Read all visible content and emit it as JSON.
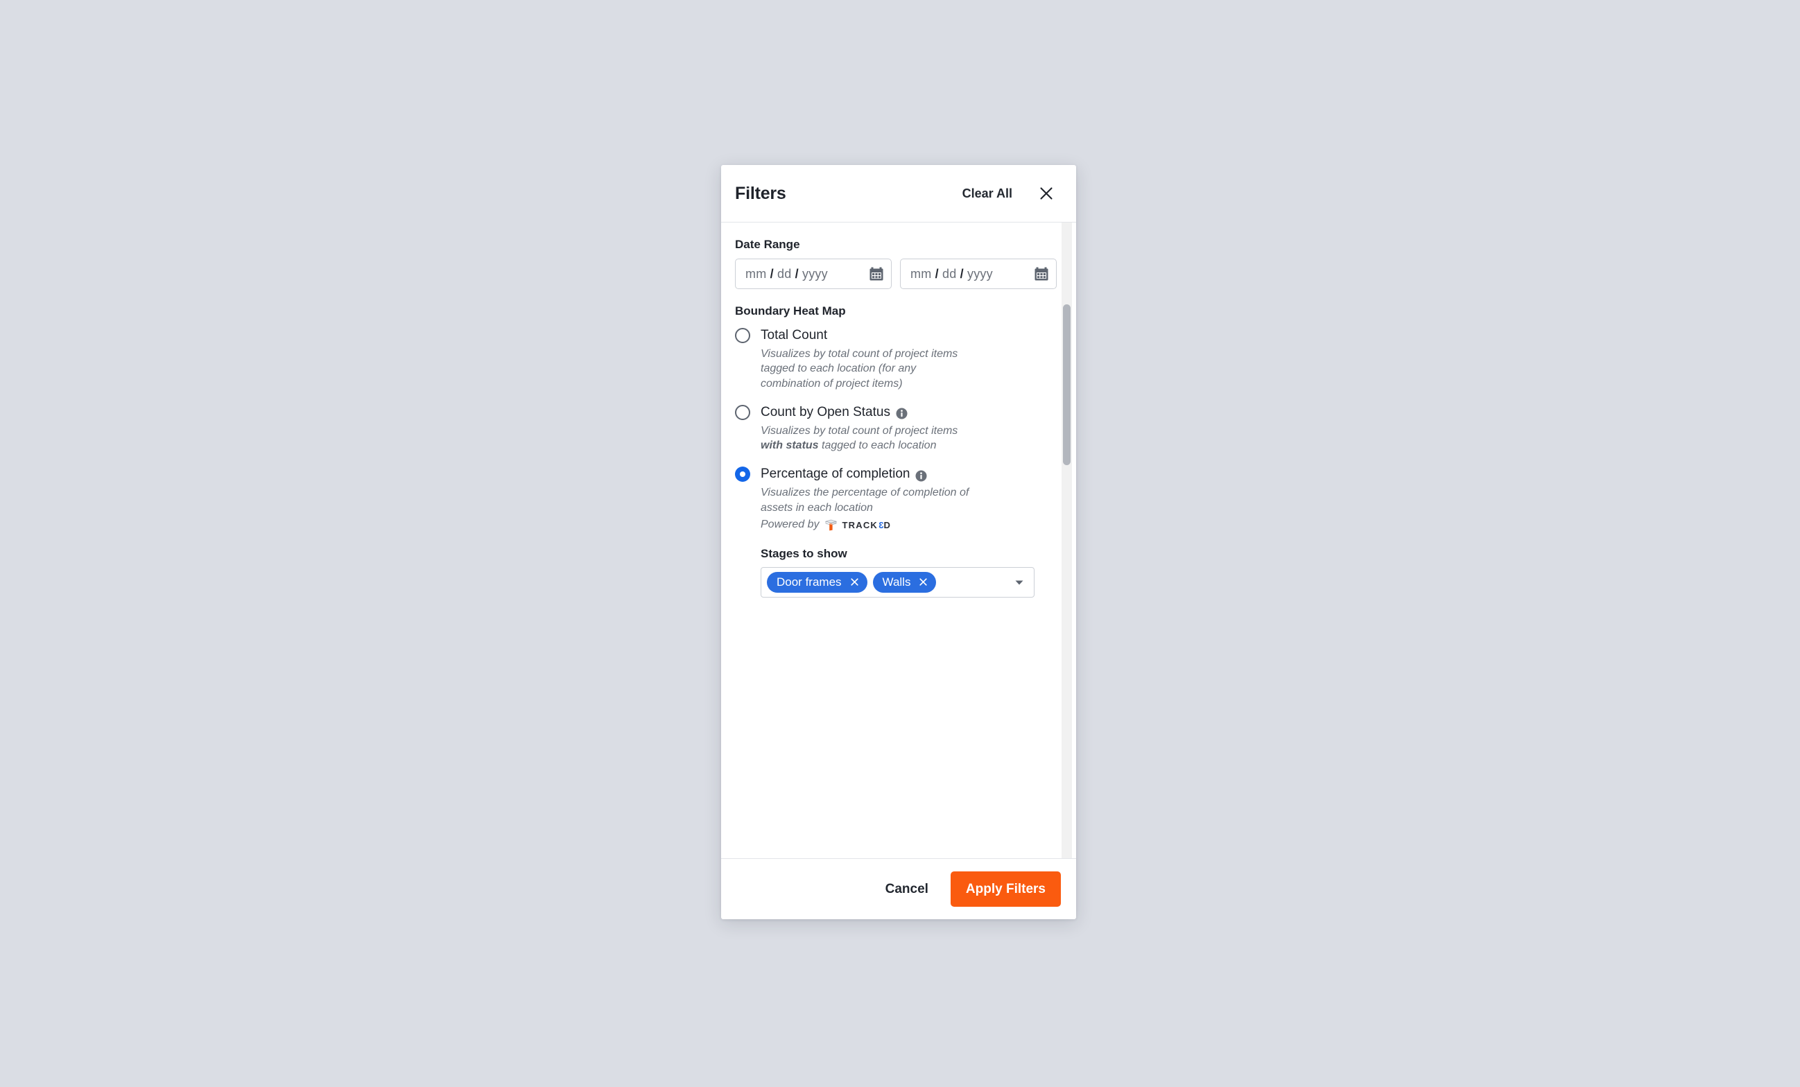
{
  "header": {
    "title": "Filters",
    "clear_all_label": "Clear All",
    "close_icon": "close-icon"
  },
  "date_range": {
    "label": "Date Range",
    "start": {
      "value": "",
      "placeholder": "mm / dd / yyyy",
      "icon": "calendar-icon"
    },
    "end": {
      "value": "",
      "placeholder": "mm / dd / yyyy",
      "icon": "calendar-icon"
    }
  },
  "boundary_heat_map": {
    "label": "Boundary Heat Map",
    "options": [
      {
        "id": "total-count",
        "label": "Total Count",
        "selected": false,
        "has_info_icon": false,
        "description": "Visualizes by total count of project items tagged to each location (for any combination of project items)"
      },
      {
        "id": "count-by-open-status",
        "label": "Count by Open Status",
        "selected": false,
        "has_info_icon": true,
        "description_part1": "Visualizes by total count of project items ",
        "description_bold": "with status",
        "description_part2": " tagged to each location"
      },
      {
        "id": "percentage-of-completion",
        "label": "Percentage of completion",
        "selected": true,
        "has_info_icon": true,
        "description": "Visualizes the percentage of completion of assets in each location",
        "powered_by_text": "Powered by",
        "powered_by_brand_prefix": "TRACK",
        "powered_by_brand_digit": "3",
        "powered_by_brand_suffix": "D"
      }
    ]
  },
  "stages": {
    "label": "Stages to show",
    "chips": [
      {
        "label": "Door frames",
        "remove_icon": "close-icon"
      },
      {
        "label": "Walls",
        "remove_icon": "close-icon"
      }
    ],
    "caret_icon": "chevron-down-icon"
  },
  "footer": {
    "cancel_label": "Cancel",
    "apply_label": "Apply Filters"
  },
  "colors": {
    "accent_orange": "#fa5b0f",
    "chip_blue": "#2b6ee0",
    "radio_blue": "#1366e8",
    "page_background": "#dadde4"
  }
}
